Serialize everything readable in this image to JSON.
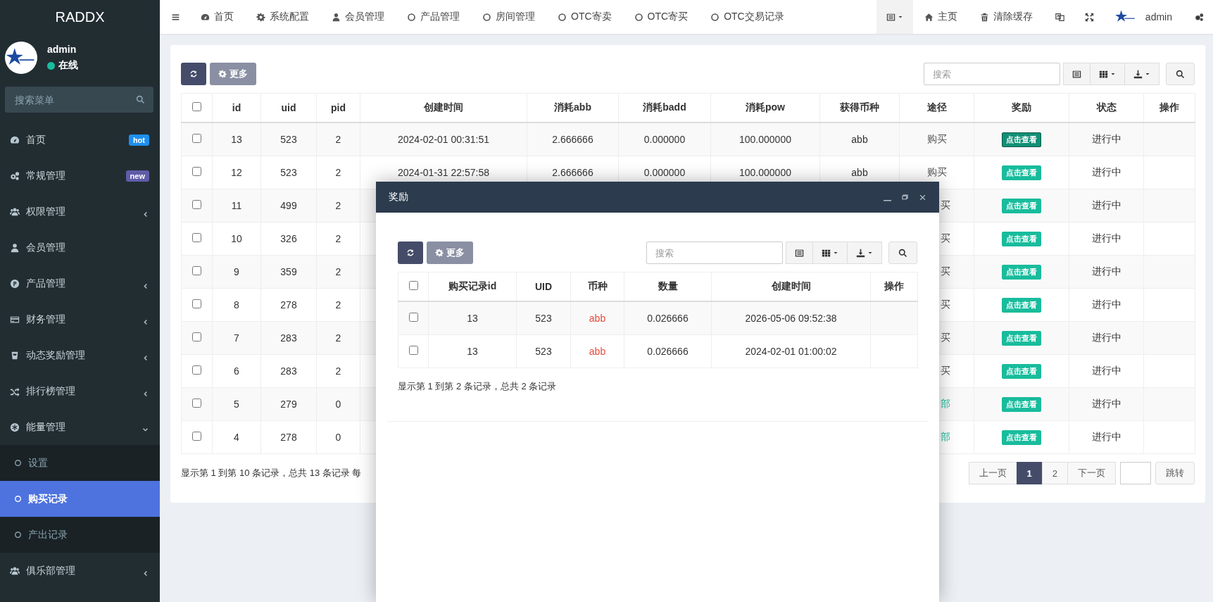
{
  "brand": "RADDX",
  "user": {
    "name": "admin",
    "status": "在线"
  },
  "sidebar": {
    "search_placeholder": "搜索菜单",
    "items": [
      {
        "label": "首页",
        "badge": {
          "text": "hot",
          "color": "#1e8ff0"
        }
      },
      {
        "label": "常规管理",
        "badge": {
          "text": "new",
          "color": "#605ca8"
        }
      },
      {
        "label": "权限管理",
        "expanded": false
      },
      {
        "label": "会员管理"
      },
      {
        "label": "产品管理",
        "expanded": false
      },
      {
        "label": "财务管理",
        "expanded": false
      },
      {
        "label": "动态奖励管理",
        "expanded": false
      },
      {
        "label": "排行榜管理",
        "expanded": false
      },
      {
        "label": "能量管理",
        "expanded": true,
        "children": [
          {
            "label": "设置",
            "selected": false
          },
          {
            "label": "购买记录",
            "selected": true
          },
          {
            "label": "产出记录",
            "selected": false
          }
        ]
      },
      {
        "label": "俱乐部管理",
        "expanded": false
      }
    ]
  },
  "topbar": {
    "nav": [
      "首页",
      "系统配置",
      "会员管理",
      "产品管理",
      "房间管理",
      "OTC寄卖",
      "OTC寄买",
      "OTC交易记录"
    ],
    "home": "主页",
    "clear_cache": "清除缓存",
    "user": "admin"
  },
  "toolbar": {
    "more": "更多",
    "search_placeholder": "搜索"
  },
  "table": {
    "header_checked": false,
    "columns": [
      "id",
      "uid",
      "pid",
      "创建时间",
      "消耗abb",
      "消耗badd",
      "消耗pow",
      "获得币种",
      "途径",
      "奖励",
      "状态",
      "操作"
    ],
    "rows": [
      {
        "checked": false,
        "id": "13",
        "uid": "523",
        "pid": "2",
        "created": "2024-02-01 00:31:51",
        "cost_abb": "2.666666",
        "cost_badd": "0.000000",
        "cost_pow": "100.000000",
        "coin": "abb",
        "route": "购买",
        "route_link": false,
        "reward": {
          "label": "点击查看",
          "focused": true
        },
        "status": "进行中"
      },
      {
        "checked": false,
        "id": "12",
        "uid": "523",
        "pid": "2",
        "created": "2024-01-31 22:57:58",
        "cost_abb": "2.666666",
        "cost_badd": "0.000000",
        "cost_pow": "100.000000",
        "coin": "abb",
        "route": "购买",
        "route_link": false,
        "reward": {
          "label": "点击查看",
          "focused": false
        },
        "status": "进行中"
      },
      {
        "checked": false,
        "id": "11",
        "uid": "499",
        "pid": "2",
        "route": "买",
        "route_link": false,
        "reward": {
          "label": "点击查看",
          "focused": false
        },
        "status": "进行中"
      },
      {
        "checked": false,
        "id": "10",
        "uid": "326",
        "pid": "2",
        "route": "买",
        "route_link": false,
        "reward": {
          "label": "点击查看",
          "focused": false
        },
        "status": "进行中"
      },
      {
        "checked": false,
        "id": "9",
        "uid": "359",
        "pid": "2",
        "route": "买",
        "route_link": false,
        "reward": {
          "label": "点击查看",
          "focused": false
        },
        "status": "进行中"
      },
      {
        "checked": false,
        "id": "8",
        "uid": "278",
        "pid": "2",
        "route": "买",
        "route_link": false,
        "reward": {
          "label": "点击查看",
          "focused": false
        },
        "status": "进行中"
      },
      {
        "checked": false,
        "id": "7",
        "uid": "283",
        "pid": "2",
        "route": "买",
        "route_link": false,
        "reward": {
          "label": "点击查看",
          "focused": false
        },
        "status": "进行中"
      },
      {
        "checked": false,
        "id": "6",
        "uid": "283",
        "pid": "2",
        "route": "买",
        "route_link": false,
        "reward": {
          "label": "点击查看",
          "focused": false
        },
        "status": "进行中"
      },
      {
        "checked": false,
        "id": "5",
        "uid": "279",
        "pid": "0",
        "route": "部",
        "route_link": true,
        "reward": {
          "label": "点击查看",
          "focused": false
        },
        "status": "进行中"
      },
      {
        "checked": false,
        "id": "4",
        "uid": "278",
        "pid": "0",
        "route": "部",
        "route_link": true,
        "reward": {
          "label": "点击查看",
          "focused": false
        },
        "status": "进行中"
      }
    ]
  },
  "pagination": {
    "info": "显示第 1 到第 10 条记录，总共 13 条记录 每",
    "prev": "上一页",
    "pages": [
      {
        "label": "1",
        "selected": true
      },
      {
        "label": "2",
        "selected": false
      }
    ],
    "next": "下一页",
    "jump": "跳转"
  },
  "modal": {
    "title": "奖励",
    "toolbar": {
      "more": "更多",
      "search_placeholder": "搜索"
    },
    "table": {
      "header_checked": false,
      "columns": [
        "购买记录id",
        "UID",
        "币种",
        "数量",
        "创建时间",
        "操作"
      ],
      "rows": [
        {
          "checked": false,
          "record_id": "13",
          "uid": "523",
          "coin": "abb",
          "amount": "0.026666",
          "created": "2026-05-06 09:52:38"
        },
        {
          "checked": false,
          "record_id": "13",
          "uid": "523",
          "coin": "abb",
          "amount": "0.026666",
          "created": "2024-02-01 01:00:02"
        }
      ]
    },
    "info": "显示第 1 到第 2 条记录，总共 2 条记录"
  }
}
